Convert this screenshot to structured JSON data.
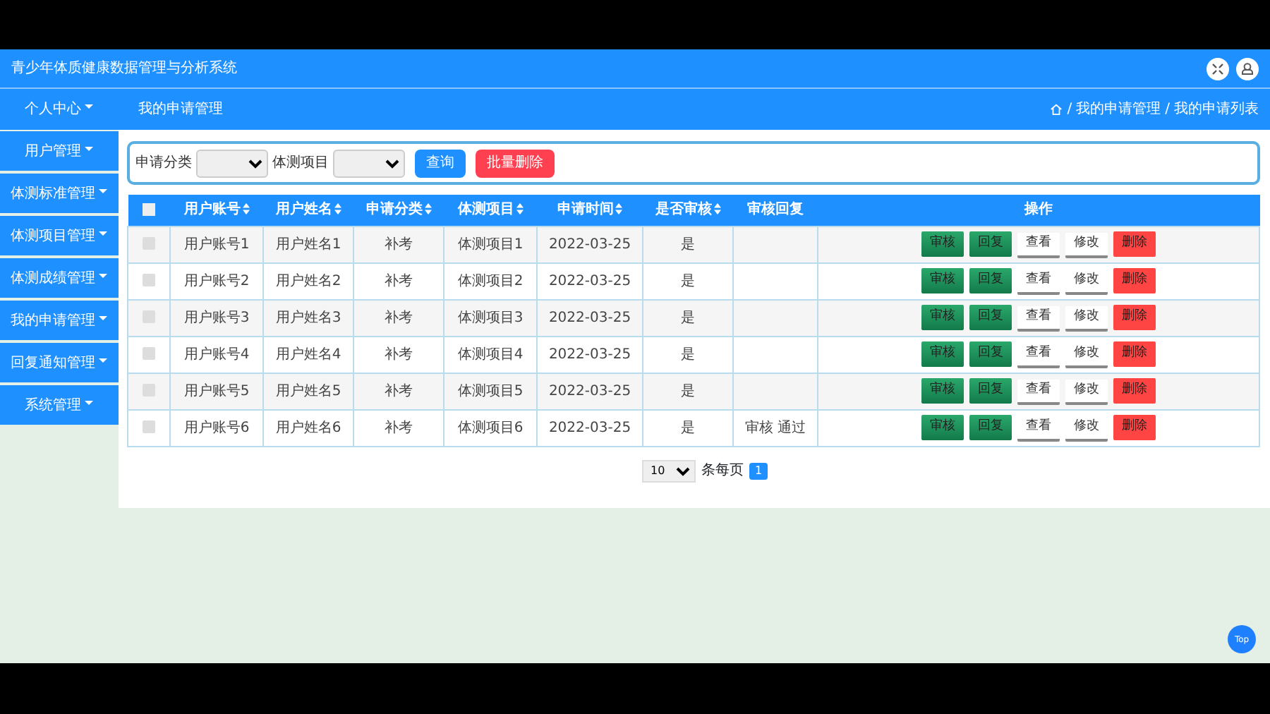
{
  "header": {
    "title": "青少年体质健康数据管理与分析系统"
  },
  "nav": {
    "menu": {
      "label": "个人中心",
      "expanded": false
    },
    "page_title": "我的申请管理",
    "breadcrumb": [
      "/",
      "我的申请管理",
      "/",
      "我的申请列表"
    ]
  },
  "sidebar": {
    "items": [
      {
        "label": "用户管理"
      },
      {
        "label": "体测标准管理"
      },
      {
        "label": "体测项目管理"
      },
      {
        "label": "体测成绩管理"
      },
      {
        "label": "我的申请管理"
      },
      {
        "label": "回复通知管理"
      },
      {
        "label": "系统管理"
      }
    ]
  },
  "filter": {
    "fields": [
      {
        "label": "申请分类"
      },
      {
        "label": "体测项目"
      }
    ],
    "buttons": [
      {
        "label": "查询",
        "kind": "primary"
      },
      {
        "label": "批量删除",
        "kind": "danger"
      }
    ]
  },
  "table": {
    "select_all_checked": false,
    "columns": [
      {
        "label": "用户账号",
        "sortable": true
      },
      {
        "label": "用户姓名",
        "sortable": true
      },
      {
        "label": "申请分类",
        "sortable": true
      },
      {
        "label": "体测项目",
        "sortable": true
      },
      {
        "label": "申请时间",
        "sortable": true
      },
      {
        "label": "是否审核",
        "sortable": true
      },
      {
        "label": "审核回复",
        "sortable": false
      },
      {
        "label": "操作",
        "sortable": false
      }
    ],
    "rows": [
      {
        "checked": false,
        "cells": [
          "用户账号1",
          "用户姓名1",
          "补考",
          "体测项目1",
          "2022-03-25",
          "是",
          ""
        ],
        "actions": [
          {
            "label": "审核",
            "kind": "success"
          },
          {
            "label": "回复",
            "kind": "success"
          },
          {
            "label": "查看",
            "kind": "plain"
          },
          {
            "label": "修改",
            "kind": "plain"
          },
          {
            "label": "删除",
            "kind": "danger"
          }
        ]
      },
      {
        "checked": false,
        "cells": [
          "用户账号2",
          "用户姓名2",
          "补考",
          "体测项目2",
          "2022-03-25",
          "是",
          ""
        ],
        "actions": [
          {
            "label": "审核",
            "kind": "success"
          },
          {
            "label": "回复",
            "kind": "success"
          },
          {
            "label": "查看",
            "kind": "plain"
          },
          {
            "label": "修改",
            "kind": "plain"
          },
          {
            "label": "删除",
            "kind": "danger"
          }
        ]
      },
      {
        "checked": false,
        "cells": [
          "用户账号3",
          "用户姓名3",
          "补考",
          "体测项目3",
          "2022-03-25",
          "是",
          ""
        ],
        "actions": [
          {
            "label": "审核",
            "kind": "success"
          },
          {
            "label": "回复",
            "kind": "success"
          },
          {
            "label": "查看",
            "kind": "plain"
          },
          {
            "label": "修改",
            "kind": "plain"
          },
          {
            "label": "删除",
            "kind": "danger"
          }
        ]
      },
      {
        "checked": false,
        "cells": [
          "用户账号4",
          "用户姓名4",
          "补考",
          "体测项目4",
          "2022-03-25",
          "是",
          ""
        ],
        "actions": [
          {
            "label": "审核",
            "kind": "success"
          },
          {
            "label": "回复",
            "kind": "success"
          },
          {
            "label": "查看",
            "kind": "plain"
          },
          {
            "label": "修改",
            "kind": "plain"
          },
          {
            "label": "删除",
            "kind": "danger"
          }
        ]
      },
      {
        "checked": false,
        "cells": [
          "用户账号5",
          "用户姓名5",
          "补考",
          "体测项目5",
          "2022-03-25",
          "是",
          ""
        ],
        "actions": [
          {
            "label": "审核",
            "kind": "success"
          },
          {
            "label": "回复",
            "kind": "success"
          },
          {
            "label": "查看",
            "kind": "plain"
          },
          {
            "label": "修改",
            "kind": "plain"
          },
          {
            "label": "删除",
            "kind": "danger"
          }
        ]
      },
      {
        "checked": false,
        "cells": [
          "用户账号6",
          "用户姓名6",
          "补考",
          "体测项目6",
          "2022-03-25",
          "是",
          "审核 通过"
        ],
        "actions": [
          {
            "label": "审核",
            "kind": "success"
          },
          {
            "label": "回复",
            "kind": "success"
          },
          {
            "label": "查看",
            "kind": "plain"
          },
          {
            "label": "修改",
            "kind": "plain"
          },
          {
            "label": "删除",
            "kind": "danger"
          }
        ]
      }
    ]
  },
  "pagination": {
    "page_size": "10",
    "per_page_label": "条每页",
    "pages": [
      {
        "label": "1",
        "selected": true
      }
    ]
  },
  "top_button": "Top"
}
